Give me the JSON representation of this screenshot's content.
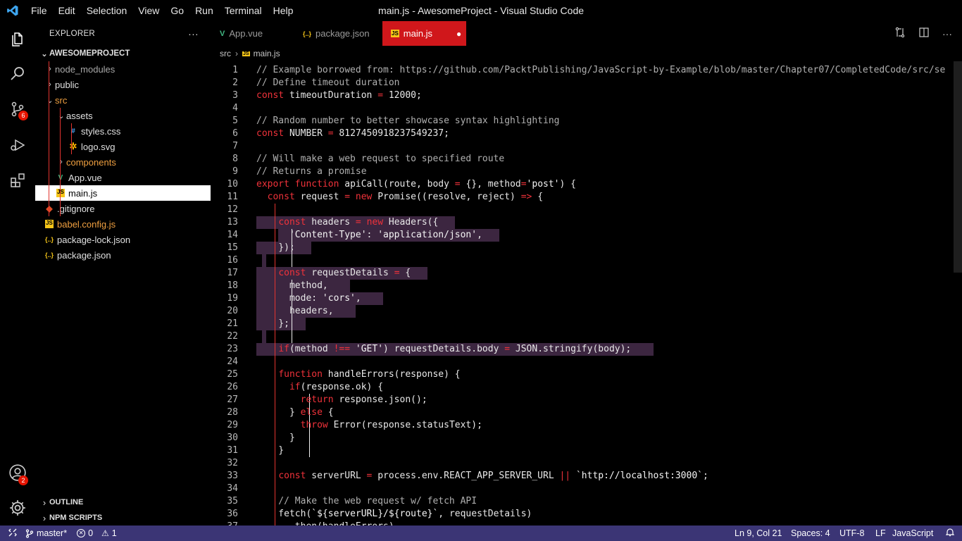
{
  "window": {
    "title": "main.js - AwesomeProject - Visual Studio Code"
  },
  "menu": [
    "File",
    "Edit",
    "Selection",
    "View",
    "Go",
    "Run",
    "Terminal",
    "Help"
  ],
  "activity": {
    "scm_badge": "6",
    "account_badge": "2"
  },
  "sidebar": {
    "title": "EXPLORER",
    "more": "···",
    "project": "AWESOMEPROJECT",
    "tree": [
      {
        "label": "node_modules",
        "kind": "folder"
      },
      {
        "label": "public",
        "kind": "folder"
      },
      {
        "label": "src",
        "kind": "folder-open"
      },
      {
        "label": "assets",
        "kind": "folder-open"
      },
      {
        "label": "styles.css",
        "kind": "css"
      },
      {
        "label": "logo.svg",
        "kind": "svg"
      },
      {
        "label": "components",
        "kind": "folder"
      },
      {
        "label": "App.vue",
        "kind": "vue"
      },
      {
        "label": "main.js",
        "kind": "js"
      },
      {
        "label": ".gitignore",
        "kind": "git"
      },
      {
        "label": "babel.config.js",
        "kind": "js"
      },
      {
        "label": "package-lock.json",
        "kind": "json"
      },
      {
        "label": "package.json",
        "kind": "json"
      }
    ],
    "outline": "OUTLINE",
    "npm_scripts": "NPM SCRIPTS"
  },
  "tabs": [
    {
      "label": "App.vue",
      "icon": "V"
    },
    {
      "label": "package.json",
      "icon": "{..}"
    },
    {
      "label": "main.js",
      "icon": "JS",
      "active": true,
      "modified_dot": "●"
    }
  ],
  "breadcrumb": {
    "folder": "src",
    "sep": "›",
    "file": "main.js"
  },
  "code": [
    "// Example borrowed from: https://github.com/PacktPublishing/JavaScript-by-Example/blob/master/Chapter07/CompletedCode/src/se",
    "// Define timeout duration",
    "const timeoutDuration = 12000;",
    "",
    "// Random number to better showcase syntax highlighting",
    "const NUMBER = 812745091823754O9237;",
    "",
    "// Will make a web request to specified route",
    "// Returns a promise",
    "export function apiCall(route, body = {}, method='post') {",
    "  const request = new Promise((resolve, reject) => {",
    "",
    "    const headers = new Headers({",
    "      'Content-Type': 'application/json',",
    "    });",
    "",
    "    const requestDetails = {",
    "      method,",
    "      mode: 'cors',",
    "      headers,",
    "    };",
    "",
    "    if(method !== 'GET') requestDetails.body = JSON.stringify(body);",
    "",
    "    function handleErrors(response) {",
    "      if(response.ok) {",
    "        return response.json();",
    "      } else {",
    "        throw Error(response.statusText);",
    "      }",
    "    }",
    "",
    "    const serverURL = process.env.REACT_APP_SERVER_URL || `http://localhost:3000`;",
    "",
    "    // Make the web request w/ fetch API",
    "    fetch(`${serverURL}/${route}`, requestDetails)",
    "      .then(handleErrors)"
  ],
  "status": {
    "branch": "master*",
    "errors": "0",
    "warnings": "1",
    "position": "Ln 9, Col 21",
    "spaces": "Spaces: 4",
    "encoding": "UTF-8",
    "eol": "LF",
    "language": "JavaScript"
  },
  "colors": {
    "accent": "#d0171b",
    "statusbar": "#3b3575",
    "selection": "#3c2640"
  }
}
